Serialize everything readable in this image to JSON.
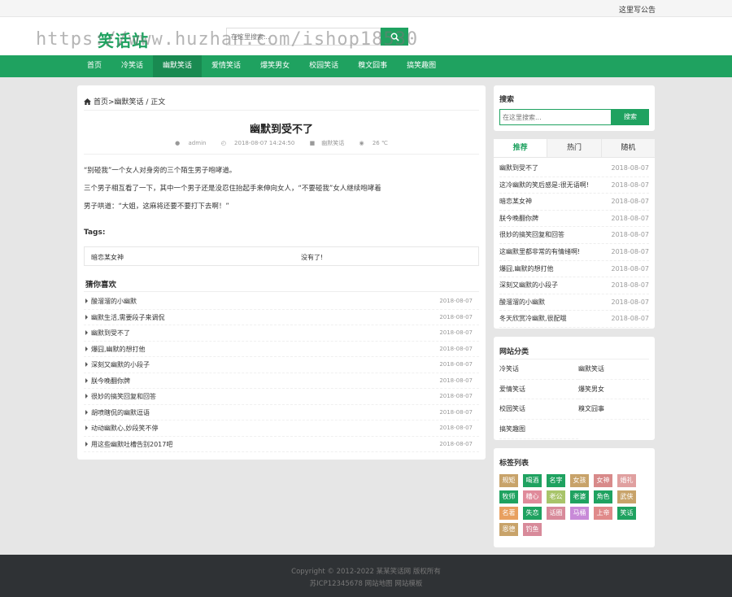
{
  "topbar": {
    "notice": "这里写公告"
  },
  "header": {
    "logo": "笑话站",
    "watermark": "https://www.huzhan.com/ishop18530",
    "search_placeholder": "在这里搜索..."
  },
  "nav": [
    "首页",
    "冷笑话",
    "幽默笑话",
    "爱情笑话",
    "爆笑男女",
    "校园笑话",
    "糗文囧事",
    "搞笑趣图"
  ],
  "nav_active": 2,
  "article": {
    "breadcrumb": "首页>幽默笑话 / 正文",
    "title": "幽默到受不了",
    "meta": {
      "author": "admin",
      "date": "2018-08-07 14:24:50",
      "category": "幽默笑话",
      "temp": "26 ℃"
    },
    "paragraphs": [
      "“别碰我”一个女人对身旁的三个陌生男子咆哮道。",
      "三个男子相互看了一下，其中一个男子还是没忍住抬起手来伸向女人，“不要碰我”女人继续咆哮着",
      "男子哄道：“大姐，这麻将还要不要打下去啊！”"
    ],
    "tags_label": "Tags:",
    "tag": "暗恋某女神",
    "tag_none": "没有了!",
    "guess_title": "猜你喜欢",
    "guess": [
      {
        "title": "酸溜溜的小幽默",
        "date": "2018-08-07"
      },
      {
        "title": "幽默生活,需要段子来调侃",
        "date": "2018-08-07"
      },
      {
        "title": "幽默到受不了",
        "date": "2018-08-07"
      },
      {
        "title": "爆囧,幽默的想打他",
        "date": "2018-08-07"
      },
      {
        "title": "深刻又幽默的小段子",
        "date": "2018-08-07"
      },
      {
        "title": "朕今晚翻你牌",
        "date": "2018-08-07"
      },
      {
        "title": "很妙的搞笑回复和回答",
        "date": "2018-08-07"
      },
      {
        "title": "胡喷瞎侃的幽默逗语",
        "date": "2018-08-07"
      },
      {
        "title": "动动幽默心,妙段笑不停",
        "date": "2018-08-07"
      },
      {
        "title": "用这些幽默吐槽告别2017吧",
        "date": "2018-08-07"
      }
    ]
  },
  "sidebar": {
    "search_title": "搜索",
    "search_placeholder": "在这里搜索...",
    "search_button": "搜索",
    "tabs": [
      "推荐",
      "热门",
      "随机"
    ],
    "tab_items": [
      {
        "title": "幽默到受不了",
        "date": "2018-08-07"
      },
      {
        "title": "这冷幽默的笑后感是:很无语啊!",
        "date": "2018-08-07"
      },
      {
        "title": "暗恋某女神",
        "date": "2018-08-07"
      },
      {
        "title": "朕今晚翻你牌",
        "date": "2018-08-07"
      },
      {
        "title": "很妙的搞笑回复和回答",
        "date": "2018-08-07"
      },
      {
        "title": "这幽默里都非常的有情绪啊!",
        "date": "2018-08-07"
      },
      {
        "title": "爆囧,幽默的想打他",
        "date": "2018-08-07"
      },
      {
        "title": "深刻又幽默的小段子",
        "date": "2018-08-07"
      },
      {
        "title": "酸溜溜的小幽默",
        "date": "2018-08-07"
      },
      {
        "title": "冬天欣赏冷幽默,很配哦",
        "date": "2018-08-07"
      }
    ],
    "cat_title": "网站分类",
    "categories": [
      "冷笑话",
      "幽默笑话",
      "爱情笑话",
      "爆笑男女",
      "校园笑话",
      "糗文囧事",
      "搞笑趣图"
    ],
    "tags_title": "标签列表",
    "tags": [
      {
        "label": "规矩",
        "color": "#c8a36a"
      },
      {
        "label": "喝酒",
        "color": "#1fa260"
      },
      {
        "label": "名字",
        "color": "#1fa260"
      },
      {
        "label": "女孩",
        "color": "#c8a36a"
      },
      {
        "label": "女神",
        "color": "#d88a8a"
      },
      {
        "label": "婚礼",
        "color": "#e0a0a0"
      },
      {
        "label": "牧师",
        "color": "#1fa260"
      },
      {
        "label": "糟心",
        "color": "#e08a9a"
      },
      {
        "label": "老公",
        "color": "#a8c46a"
      },
      {
        "label": "老婆",
        "color": "#1fa260"
      },
      {
        "label": "角色",
        "color": "#1fa260"
      },
      {
        "label": "武侠",
        "color": "#c8a36a"
      },
      {
        "label": "名著",
        "color": "#e8a060"
      },
      {
        "label": "失恋",
        "color": "#1fa260"
      },
      {
        "label": "话圈",
        "color": "#d88a9a"
      },
      {
        "label": "马桶",
        "color": "#c88ad8"
      },
      {
        "label": "上帝",
        "color": "#e08a8a"
      },
      {
        "label": "笑话",
        "color": "#1fa260"
      },
      {
        "label": "恩德",
        "color": "#c8a36a"
      },
      {
        "label": "钓鱼",
        "color": "#d88a9a"
      }
    ]
  },
  "footer": {
    "line1": "Copyright © 2012-2022 某某笑话网 版权所有",
    "line2": "苏ICP12345678 网站地图 网站模板"
  }
}
